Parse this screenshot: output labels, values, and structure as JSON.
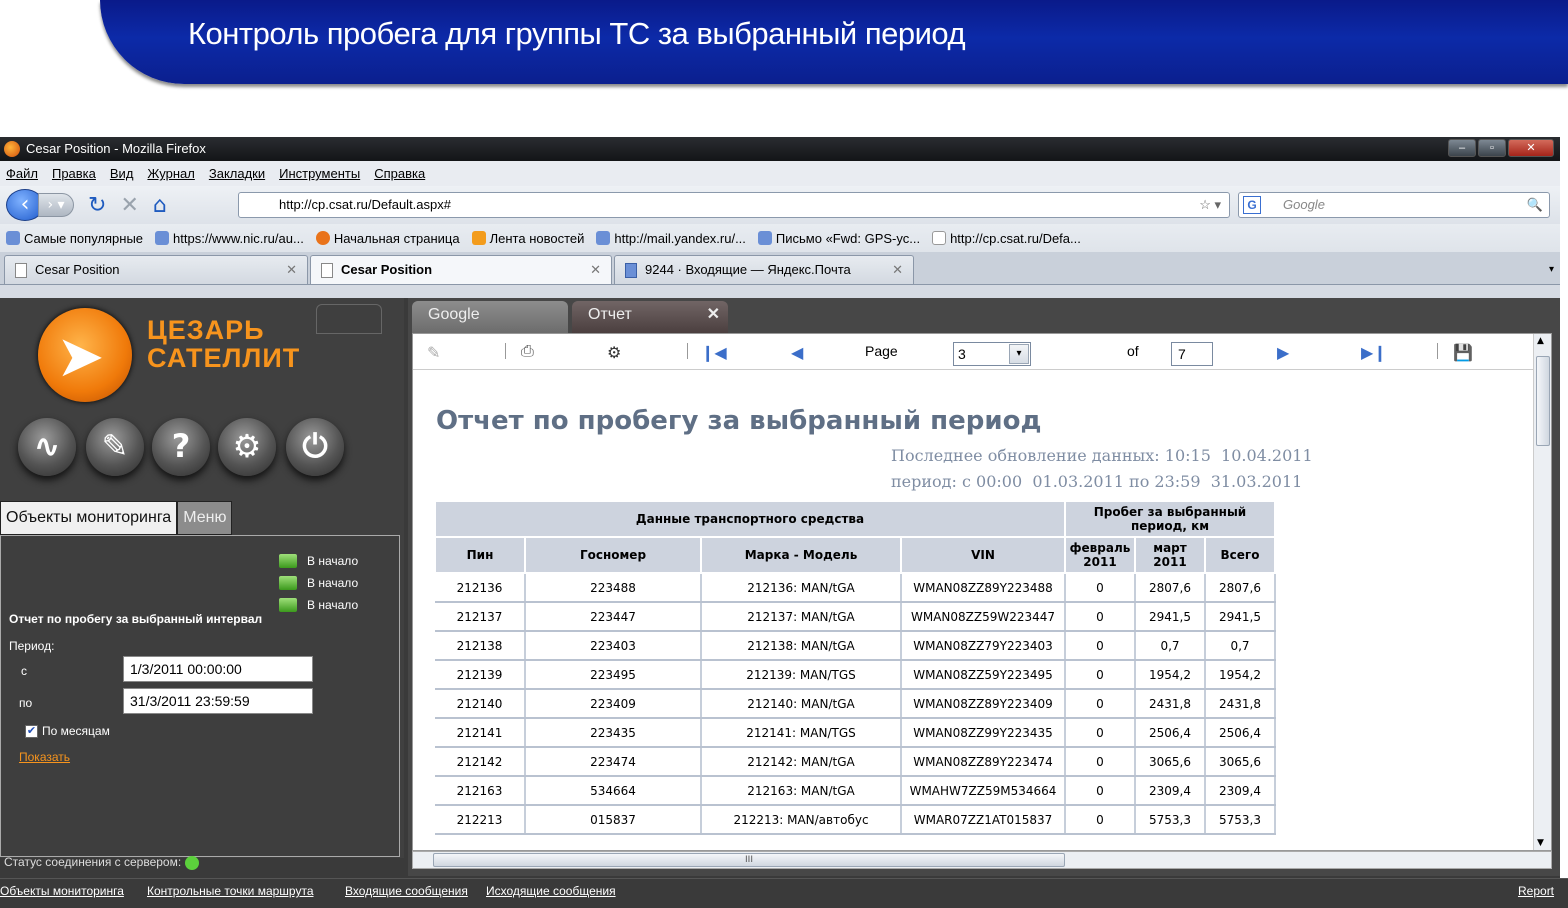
{
  "banner": {
    "title": "Контроль пробега для группы ТС за выбранный период"
  },
  "window": {
    "title": "Cesar Position - Mozilla Firefox"
  },
  "menu": [
    "Файл",
    "Правка",
    "Вид",
    "Журнал",
    "Закладки",
    "Инструменты",
    "Справка"
  ],
  "address": {
    "url": "http://cp.csat.ru/Default.aspx#",
    "search_placeholder": "Google"
  },
  "bookmarks": [
    "Самые популярные",
    "https://www.nic.ru/au...",
    "Начальная страница",
    "Лента новостей",
    "http://mail.yandex.ru/...",
    "Письмо «Fwd: GPS-ус...",
    "http://cp.csat.ru/Defa..."
  ],
  "tabs": [
    "Cesar Position",
    "Cesar Position",
    "9244 · Входящие — Яндекс.Почта"
  ],
  "app": {
    "logo_line1": "ЦЕЗАРЬ",
    "logo_line2": "САТЕЛЛИТ",
    "left_tabs": [
      "Объекты мониторинга",
      "Меню"
    ],
    "to_start": [
      "В начало",
      "В начало",
      "В начало"
    ],
    "report_heading": "Отчет по пробегу за выбранный интервал",
    "period_label": "Период:",
    "from_label": "с",
    "from_value": "1/3/2011 00:00:00",
    "to_label": "по",
    "to_value": "31/3/2011 23:59:59",
    "by_month": "По месяцам",
    "show_link": "Показать",
    "status": "Статус соединения с сервером:"
  },
  "right_tabs": [
    "Google",
    "Отчет"
  ],
  "report_toolbar": {
    "page_label": "Page",
    "page": "3",
    "of_label": "of",
    "total": "7"
  },
  "report": {
    "title": "Отчет по пробегу за выбранный период",
    "updated": "Последнее обновление данных: 10:15  10.04.2011",
    "period": "период: с 00:00  01.03.2011 по 23:59  31.03.2011",
    "group_vehicle": "Данные транспортного средства",
    "group_mileage": "Пробег за выбранный период, км",
    "columns": [
      "Пин",
      "Госномер",
      "Марка - Модель",
      "VIN",
      "февраль 2011",
      "март 2011",
      "Всего"
    ],
    "rows": [
      [
        "212136",
        "223488",
        "212136: MAN/tGA",
        "WMAN08ZZ89Y223488",
        "0",
        "2807,6",
        "2807,6"
      ],
      [
        "212137",
        "223447",
        "212137: MAN/tGA",
        "WMAN08ZZ59W223447",
        "0",
        "2941,5",
        "2941,5"
      ],
      [
        "212138",
        "223403",
        "212138: MAN/tGA",
        "WMAN08ZZ79Y223403",
        "0",
        "0,7",
        "0,7"
      ],
      [
        "212139",
        "223495",
        "212139: MAN/TGS",
        "WMAN08ZZ59Y223495",
        "0",
        "1954,2",
        "1954,2"
      ],
      [
        "212140",
        "223409",
        "212140: MAN/tGA",
        "WMAN08ZZ89Y223409",
        "0",
        "2431,8",
        "2431,8"
      ],
      [
        "212141",
        "223435",
        "212141: MAN/TGS",
        "WMAN08ZZ99Y223435",
        "0",
        "2506,4",
        "2506,4"
      ],
      [
        "212142",
        "223474",
        "212142: MAN/tGA",
        "WMAN08ZZ89Y223474",
        "0",
        "3065,6",
        "3065,6"
      ],
      [
        "212163",
        "534664",
        "212163: MAN/tGA",
        "WMAHW7ZZ59M534664",
        "0",
        "2309,4",
        "2309,4"
      ],
      [
        "212213",
        "015837",
        "212213: MAN/автобус",
        "WMAR07ZZ1AT015837",
        "0",
        "5753,3",
        "5753,3"
      ]
    ]
  },
  "footer_links": [
    "Объекты мониторинга",
    "Контрольные точки маршрута",
    "Входящие сообщения",
    "Исходящие сообщения"
  ],
  "footer_right": "Report"
}
